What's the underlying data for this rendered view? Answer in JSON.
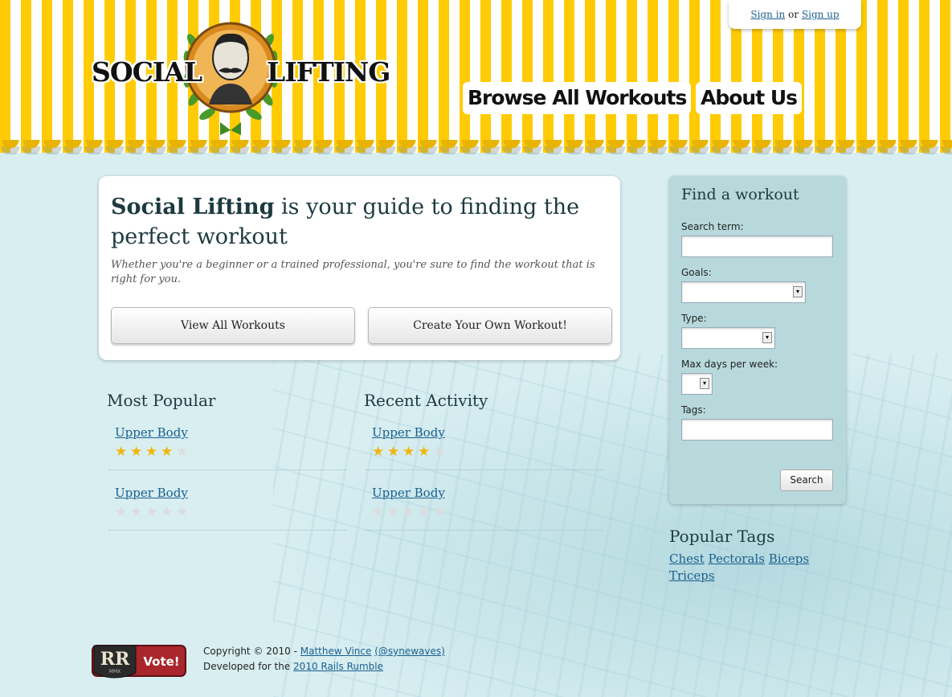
{
  "brand": {
    "logo_left": "SOCIAL",
    "logo_right": "LIFTING",
    "colors": {
      "stripe": "#ffcb05",
      "background": "#d8eef1",
      "link": "#1a5f8f",
      "star": "#f2b40f"
    }
  },
  "auth": {
    "sign_in": "Sign in",
    "separator": "or",
    "sign_up": "Sign up"
  },
  "nav": {
    "browse": "Browse All Workouts",
    "about": "About Us"
  },
  "hero": {
    "title_bold": "Social Lifting",
    "title_rest": " is your guide to finding the perfect workout",
    "subtitle": "Whether you're a beginner or a trained professional, you're sure to find the workout that is right for you.",
    "view_button": "View All Workouts",
    "create_button": "Create Your Own Workout!"
  },
  "most_popular": {
    "title": "Most Popular",
    "items": [
      {
        "name": "Upper Body",
        "rating": 4,
        "max": 5
      },
      {
        "name": "Upper Body",
        "rating": 0,
        "max": 5
      }
    ]
  },
  "recent_activity": {
    "title": "Recent Activity",
    "items": [
      {
        "name": "Upper Body",
        "rating": 4,
        "max": 5
      },
      {
        "name": "Upper Body",
        "rating": 0,
        "max": 5
      }
    ]
  },
  "finder": {
    "title": "Find a workout",
    "search_term_label": "Search term:",
    "search_term_value": "",
    "goals_label": "Goals:",
    "goals_value": "",
    "type_label": "Type:",
    "type_value": "",
    "max_days_label": "Max days per week:",
    "max_days_value": "",
    "tags_label": "Tags:",
    "tags_value": "",
    "search_button": "Search"
  },
  "popular_tags": {
    "title": "Popular Tags",
    "tags": [
      "Chest",
      "Pectorals",
      "Biceps",
      "Triceps"
    ]
  },
  "footer": {
    "badge_letters": "RR",
    "badge_year": "MMX",
    "badge_vote": "Vote!",
    "copyright_prefix": "Copyright © 2010 - ",
    "author": "Matthew Vince",
    "handle": "(@synewaves)",
    "developed_prefix": "Developed for the ",
    "event": "2010 Rails Rumble"
  }
}
